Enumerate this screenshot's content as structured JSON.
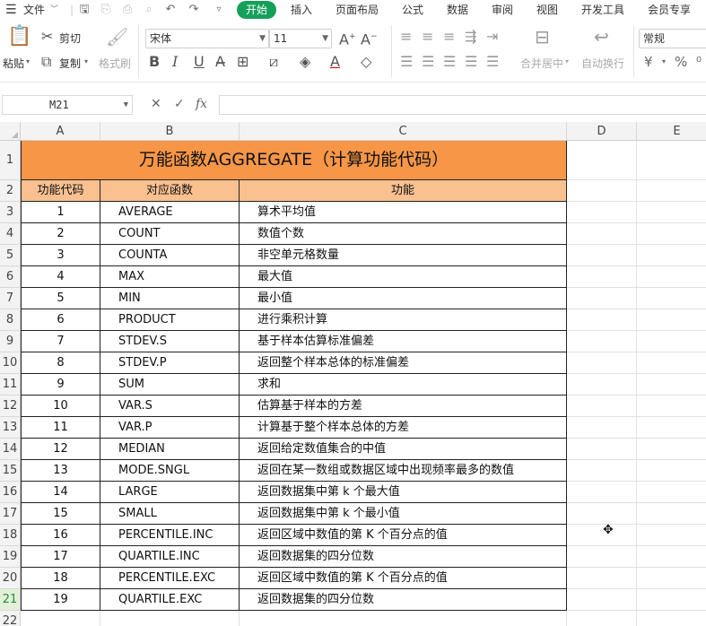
{
  "menu": {
    "file": "文件",
    "tabs": [
      "开始",
      "插入",
      "页面布局",
      "公式",
      "数据",
      "审阅",
      "视图",
      "开发工具",
      "会员专享"
    ],
    "active_tab": "开始"
  },
  "ribbon": {
    "paste": "粘贴",
    "cut": "剪切",
    "copy": "复制",
    "format_painter": "格式刷",
    "font_name": "宋体",
    "font_size": "11",
    "merge_center": "合并居中",
    "wrap_text": "自动换行",
    "number_format": "常规",
    "currency_symbol": "¥",
    "percent_symbol": "%"
  },
  "formula_bar": {
    "name_box": "M21",
    "fx": "fx",
    "value": ""
  },
  "columns": [
    "A",
    "B",
    "C",
    "D",
    "E"
  ],
  "rows": [
    "1",
    "2",
    "3",
    "4",
    "5",
    "6",
    "7",
    "8",
    "9",
    "10",
    "11",
    "12",
    "13",
    "14",
    "15",
    "16",
    "17",
    "18",
    "19",
    "20",
    "21",
    "22"
  ],
  "selected_row": "21",
  "table": {
    "title": "万能函数AGGREGATE（计算功能代码）",
    "headers": [
      "功能代码",
      "对应函数",
      "功能"
    ],
    "data": [
      [
        "1",
        "AVERAGE",
        "算术平均值"
      ],
      [
        "2",
        "COUNT",
        "数值个数"
      ],
      [
        "3",
        "COUNTA",
        "非空单元格数量"
      ],
      [
        "4",
        "MAX",
        "最大值"
      ],
      [
        "5",
        "MIN",
        "最小值"
      ],
      [
        "6",
        "PRODUCT",
        "进行乘积计算"
      ],
      [
        "7",
        "STDEV.S",
        "基于样本估算标准偏差"
      ],
      [
        "8",
        "STDEV.P",
        "返回整个样本总体的标准偏差"
      ],
      [
        "9",
        "SUM",
        "求和"
      ],
      [
        "10",
        "VAR.S",
        "估算基于样本的方差"
      ],
      [
        "11",
        "VAR.P",
        "计算基于整个样本总体的方差"
      ],
      [
        "12",
        "MEDIAN",
        "返回给定数值集合的中值"
      ],
      [
        "13",
        "MODE.SNGL",
        "返回在某一数组或数据区域中出现频率最多的数值"
      ],
      [
        "14",
        "LARGE",
        "返回数据集中第 k 个最大值"
      ],
      [
        "15",
        "SMALL",
        "返回数据集中第 k 个最小值"
      ],
      [
        "16",
        "PERCENTILE.INC",
        "返回区域中数值的第 K 个百分点的值"
      ],
      [
        "17",
        "QUARTILE.INC",
        "返回数据集的四分位数"
      ],
      [
        "18",
        "PERCENTILE.EXC",
        "返回区域中数值的第 K 个百分点的值"
      ],
      [
        "19",
        "QUARTILE.EXC",
        "返回数据集的四分位数"
      ]
    ]
  },
  "colors": {
    "title_fill": "#f79646",
    "header_fill": "#fac090",
    "active_tab": "#15a05a"
  }
}
